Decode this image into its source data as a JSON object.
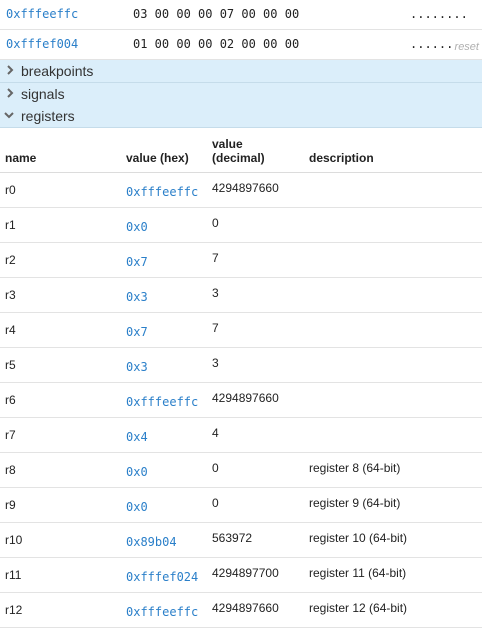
{
  "memory": {
    "rows": [
      {
        "address": "0xfffeeffc",
        "bytes": "03 00 00 00 07 00 00 00",
        "ascii": "........"
      },
      {
        "address": "0xfffef004",
        "bytes": "01 00 00 00 02 00 00 00",
        "ascii": "......"
      }
    ],
    "reset_label": "reset"
  },
  "sections": {
    "breakpoints": {
      "label": "breakpoints",
      "icon": "chevron-right-icon"
    },
    "signals": {
      "label": "signals",
      "icon": "chevron-right-icon"
    },
    "registers": {
      "label": "registers",
      "icon": "chevron-down-icon"
    }
  },
  "registers": {
    "headers": {
      "name": "name",
      "hex": "value (hex)",
      "dec_line1": "value",
      "dec_line2": "(decimal)",
      "description": "description"
    },
    "rows": [
      {
        "name": "r0",
        "hex": "0xfffeeffc",
        "dec": "4294897660",
        "desc": ""
      },
      {
        "name": "r1",
        "hex": "0x0",
        "dec": "0",
        "desc": ""
      },
      {
        "name": "r2",
        "hex": "0x7",
        "dec": "7",
        "desc": ""
      },
      {
        "name": "r3",
        "hex": "0x3",
        "dec": "3",
        "desc": ""
      },
      {
        "name": "r4",
        "hex": "0x7",
        "dec": "7",
        "desc": ""
      },
      {
        "name": "r5",
        "hex": "0x3",
        "dec": "3",
        "desc": ""
      },
      {
        "name": "r6",
        "hex": "0xfffeeffc",
        "dec": "4294897660",
        "desc": ""
      },
      {
        "name": "r7",
        "hex": "0x4",
        "dec": "4",
        "desc": ""
      },
      {
        "name": "r8",
        "hex": "0x0",
        "dec": "0",
        "desc": "register 8 (64-bit)"
      },
      {
        "name": "r9",
        "hex": "0x0",
        "dec": "0",
        "desc": "register 9 (64-bit)"
      },
      {
        "name": "r10",
        "hex": "0x89b04",
        "dec": "563972",
        "desc": "register 10 (64-bit)"
      },
      {
        "name": "r11",
        "hex": "0xfffef024",
        "dec": "4294897700",
        "desc": "register 11 (64-bit)"
      },
      {
        "name": "r12",
        "hex": "0xfffeeffc",
        "dec": "4294897660",
        "desc": "register 12 (64-bit)"
      }
    ]
  },
  "colors": {
    "link": "#2a7fc9",
    "section_bg": "#dbeefa"
  }
}
